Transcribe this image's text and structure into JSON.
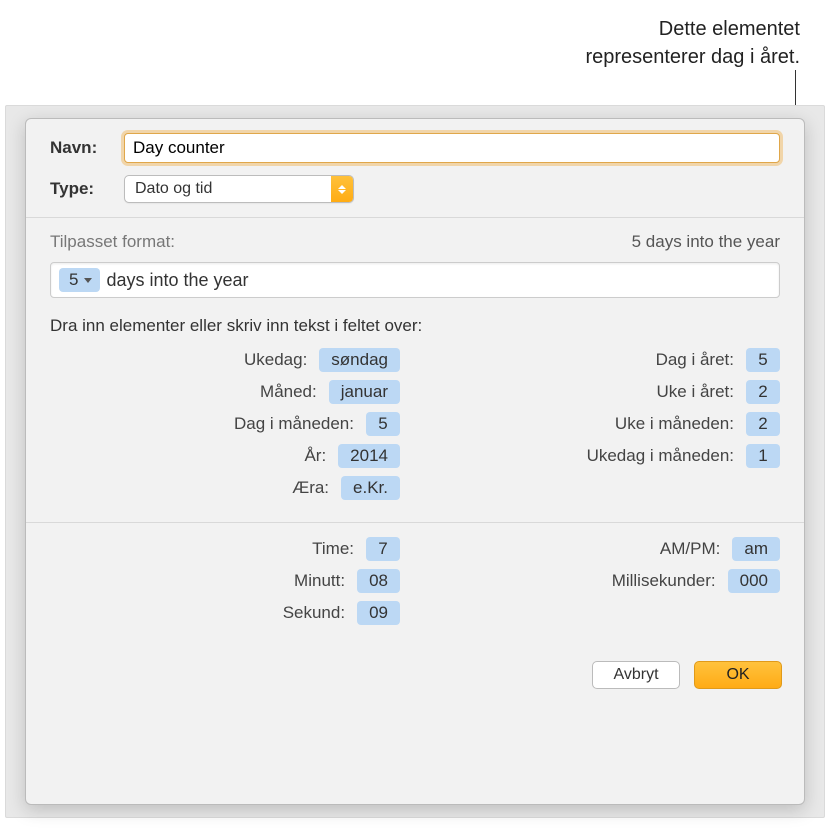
{
  "callout": {
    "line1": "Dette elementet",
    "line2": "representerer dag i året."
  },
  "fields": {
    "name_label": "Navn:",
    "name_value": "Day counter",
    "type_label": "Type:",
    "type_value": "Dato og tid"
  },
  "format": {
    "header": "Tilpasset format:",
    "preview": "5 days into the year",
    "token_value": "5",
    "suffix": "days into the year"
  },
  "instruction": "Dra inn elementer eller skriv inn tekst i feltet over:",
  "date_elements": {
    "left": [
      {
        "label": "Ukedag:",
        "value": "søndag"
      },
      {
        "label": "Måned:",
        "value": "januar"
      },
      {
        "label": "Dag i måneden:",
        "value": "5"
      },
      {
        "label": "År:",
        "value": "2014"
      },
      {
        "label": "Æra:",
        "value": "e.Kr."
      }
    ],
    "right": [
      {
        "label": "Dag i året:",
        "value": "5"
      },
      {
        "label": "Uke i året:",
        "value": "2"
      },
      {
        "label": "Uke i måneden:",
        "value": "2"
      },
      {
        "label": "Ukedag i måneden:",
        "value": "1"
      }
    ]
  },
  "time_elements": {
    "left": [
      {
        "label": "Time:",
        "value": "7"
      },
      {
        "label": "Minutt:",
        "value": "08"
      },
      {
        "label": "Sekund:",
        "value": "09"
      }
    ],
    "right": [
      {
        "label": "AM/PM:",
        "value": "am"
      },
      {
        "label": "Millisekunder:",
        "value": "000"
      }
    ]
  },
  "buttons": {
    "cancel": "Avbryt",
    "ok": "OK"
  }
}
